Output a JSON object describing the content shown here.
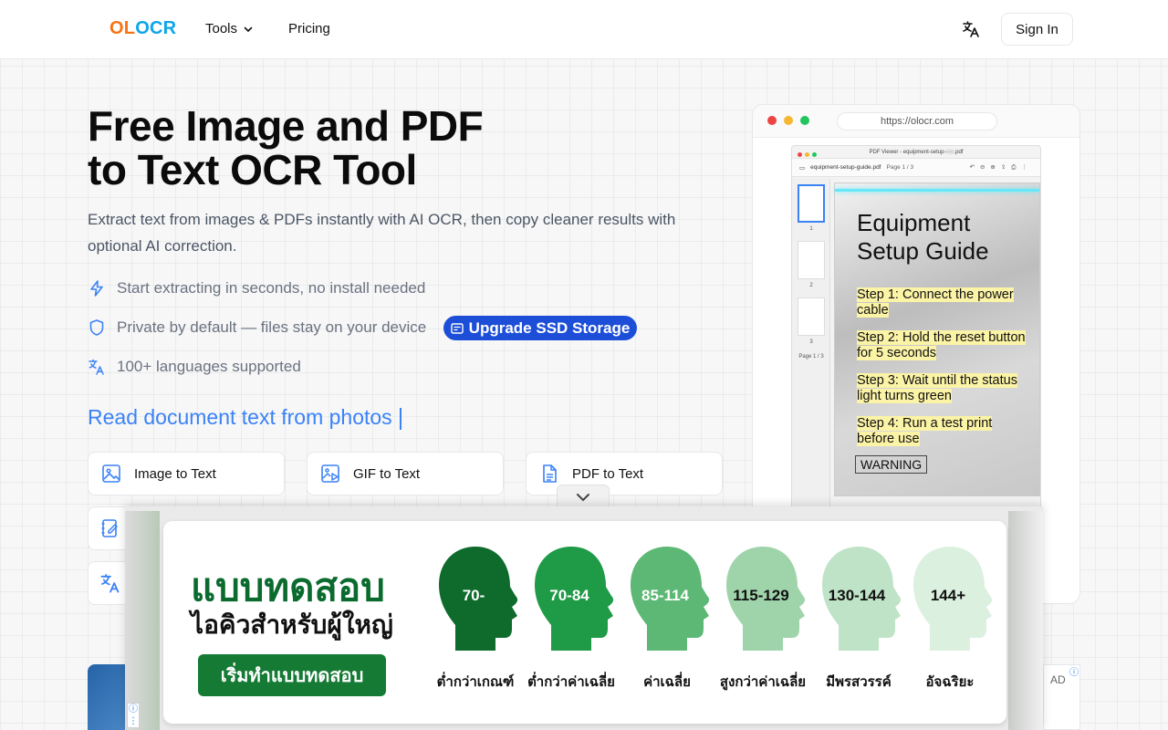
{
  "nav": {
    "logo_part1": "OL",
    "logo_part2": "OCR",
    "tools_label": "Tools",
    "pricing_label": "Pricing",
    "signin_label": "Sign In"
  },
  "hero": {
    "title_line1": "Free Image and PDF",
    "title_line2": "to Text OCR Tool",
    "subtitle": "Extract text from images & PDFs instantly with AI OCR, then copy cleaner results with optional AI correction.",
    "features": [
      {
        "icon": "lightning-icon",
        "text": "Start extracting in seconds, no install needed"
      },
      {
        "icon": "shield-icon",
        "text": "Private by default — files stay on your device"
      },
      {
        "icon": "translate-icon",
        "text": "100+ languages supported"
      }
    ],
    "upgrade_pill": "Upgrade SSD Storage",
    "typing_text": "Read document text from photos"
  },
  "tools": [
    {
      "icon": "image-icon",
      "label": "Image to Text"
    },
    {
      "icon": "gif-icon",
      "label": "GIF to Text"
    },
    {
      "icon": "pdf-file-icon",
      "label": "PDF to Text"
    }
  ],
  "preview": {
    "url": "https://olocr.com",
    "viewer_title": "PDF Viewer - equipment-setup-",
    "viewer_title_end": ".pdf",
    "file_name": "equipment-setup-guide.pdf",
    "page_indicator": "Page 1 / 3",
    "thumb_nums": [
      "1",
      "2",
      "3"
    ],
    "thumb_footer": "Page 1 / 3",
    "doc_heading": "Equipment Setup Guide",
    "steps": [
      "Step 1: Connect the power cable",
      "Step 2: Hold the reset button for 5 seconds",
      "Step 3: Wait until the status light turns green",
      "Step 4: Run a test print before use"
    ],
    "warning": "WARNING"
  },
  "ad": {
    "title": "แบบทดสอบ",
    "subtitle": "ไอคิวสำหรับผู้ใหญ่",
    "cta": "เริ่มทำแบบทดสอบ",
    "heads": [
      {
        "value": "70-",
        "label": "ต่ำกว่าเกณฑ์",
        "color": "#0f6b2c",
        "text_color": "#ffffff"
      },
      {
        "value": "70-84",
        "label": "ต่ำกว่าค่าเฉลี่ย",
        "color": "#1f9a46",
        "text_color": "#ffffff"
      },
      {
        "value": "85-114",
        "label": "ค่าเฉลี่ย",
        "color": "#5cb874",
        "text_color": "#ffffff"
      },
      {
        "value": "115-129",
        "label": "สูงกว่าค่าเฉลี่ย",
        "color": "#9fd4ab",
        "text_color": "#111111"
      },
      {
        "value": "130-144",
        "label": "มีพรสวรรค์",
        "color": "#bfe3c6",
        "text_color": "#111111"
      },
      {
        "value": "144+",
        "label": "อัจฉริยะ",
        "color": "#dcf0e0",
        "text_color": "#111111"
      }
    ],
    "ad_badge": "AD"
  },
  "colors": {
    "brand_orange": "#f97316",
    "brand_blue": "#0ea5e9",
    "accent_blue": "#3b82f6",
    "pill_blue": "#1d4ed8"
  }
}
